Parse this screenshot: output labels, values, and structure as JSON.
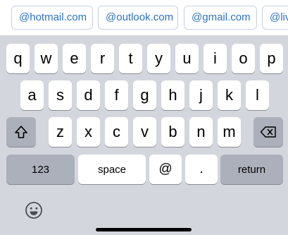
{
  "suggestions": [
    "@hotmail.com",
    "@outlook.com",
    "@gmail.com",
    "@liv"
  ],
  "rows": {
    "row1": [
      "q",
      "w",
      "e",
      "r",
      "t",
      "y",
      "u",
      "i",
      "o",
      "p"
    ],
    "row2": [
      "a",
      "s",
      "d",
      "f",
      "g",
      "h",
      "j",
      "k",
      "l"
    ],
    "row3": [
      "z",
      "x",
      "c",
      "v",
      "b",
      "n",
      "m"
    ]
  },
  "keys": {
    "numbers": "123",
    "space": "space",
    "at": "@",
    "period": ".",
    "return": "return"
  },
  "icons": {
    "shift": "shift-icon",
    "delete": "delete-icon",
    "emoji": "emoji-icon"
  },
  "colors": {
    "keyboard_bg": "#d3d6dc",
    "key_bg": "#ffffff",
    "dark_key_bg": "#abb0ba",
    "suggestion_text": "#2d73c4"
  }
}
